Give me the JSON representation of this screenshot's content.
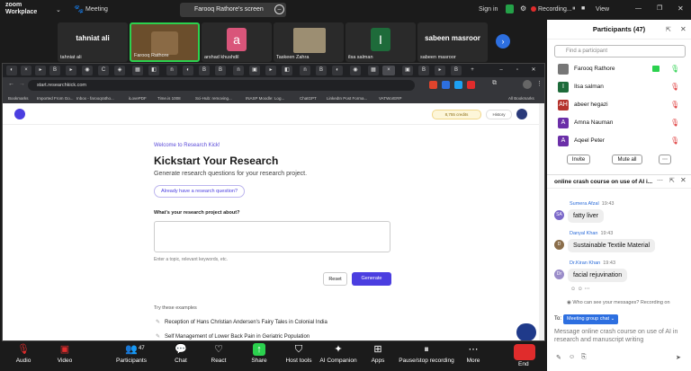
{
  "zoom": {
    "logo_line1": "zoom",
    "logo_line2": "Workplace",
    "meeting_label": "Meeting",
    "share_title": "Farooq Rathore's screen",
    "signin": "Sign in",
    "recording": "Recording...",
    "view": "View"
  },
  "video_tiles": [
    {
      "name": "tahniat ali",
      "label": "tahniat ali"
    },
    {
      "name": "Farooq Rathore"
    },
    {
      "name": "arshad khushdil",
      "initial": "a"
    },
    {
      "name": "Taskeen Zahra"
    },
    {
      "name": "ilsa salman",
      "initial": "I"
    },
    {
      "name": "sabeen masroor",
      "label": "sabeen masroor"
    }
  ],
  "browser": {
    "url": "start.researchkick.com",
    "bookmarks": [
      "Bookmarks",
      "Imported From Go...",
      "Inbox - farooqratho...",
      "iLovePDF",
      "Time.is 1008",
      "Sci-Hub: removing...",
      "INASP Moodle: Log...",
      "ChatGPT",
      "LinkedIn Post Forma...",
      "VATWorERP",
      "All Bookmarks"
    ]
  },
  "research": {
    "credits": "8,755 credits",
    "history": "History",
    "welcome": "Welcome to Research Kick!",
    "title": "Kickstart Your Research",
    "subtitle": "Generate research questions for your research project.",
    "already": "Already have a research question?",
    "question": "What's your research project about?",
    "hint": "Enter a topic, relevant keywords, etc.",
    "reset": "Reset",
    "generate": "Generate",
    "try_label": "Try these examples",
    "examples": [
      "Reception of Hans Christian Andersen's Fairy Tales in Colonial India",
      "Self Management of Lower Back Pain in Geriatric Population"
    ]
  },
  "toolbar": {
    "audio": "Audio",
    "video": "Video",
    "participants": "Participants",
    "participants_count": "47",
    "chat": "Chat",
    "react": "React",
    "share": "Share",
    "host_tools": "Host tools",
    "ai_companion": "AI Companion",
    "apps": "Apps",
    "pause_recording": "Pause/stop recording",
    "more": "More",
    "end": "End"
  },
  "participants_panel": {
    "title": "Participants (47)",
    "search_placeholder": "Find a participant",
    "list": [
      {
        "name": "Farooq Rathore",
        "initial": "",
        "color": "#777777"
      },
      {
        "name": "Ilsa salman",
        "initial": "I",
        "color": "#1e6b3a"
      },
      {
        "name": "abeer hegazi",
        "initial": "AH",
        "color": "#b5322c"
      },
      {
        "name": "Amna Nauman",
        "initial": "A",
        "color": "#6b2fa8"
      },
      {
        "name": "Aqeel Peter",
        "initial": "A",
        "color": "#6b2fa8"
      }
    ],
    "invite": "Invite",
    "mute_all": "Mute all"
  },
  "chat_panel": {
    "title": "online crash course on use of AI i...",
    "messages": [
      {
        "sender": "Sumera Afzal",
        "time": "19:43",
        "text": "fatty liver",
        "avatar": "SA",
        "color": "#7b68c9"
      },
      {
        "sender": "Danyal Khan",
        "time": "19:43",
        "text": "Sustainable Textile Material",
        "avatar": "D",
        "color": "#8a6d4a"
      },
      {
        "sender": "Dr.Kiran Khan",
        "time": "19:43",
        "text": "facial rejuvination",
        "avatar": "Dr",
        "color": "#9a8cc9"
      }
    ],
    "visibility_note": "Who can see your messages? Recording on",
    "to_label": "To:",
    "recipient": "Meeting group chat",
    "input_placeholder": "Message online crash course on use of AI in research and manuscript writing"
  }
}
